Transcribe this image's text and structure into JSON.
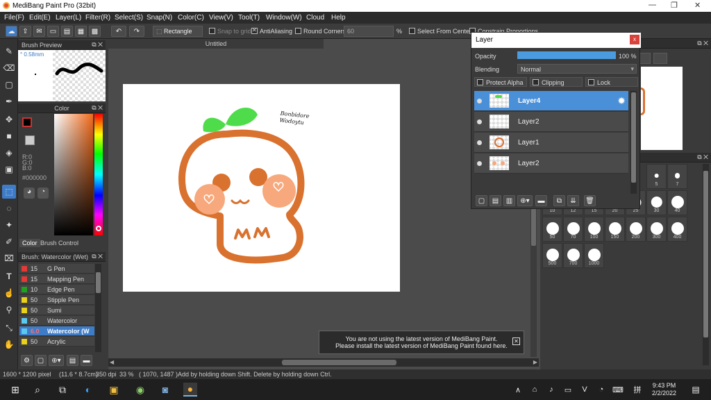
{
  "window": {
    "title": "MediBang Paint Pro (32bit)",
    "minimize": "—",
    "restore": "❐",
    "close": "✕"
  },
  "menu": [
    "File(F)",
    "Edit(E)",
    "Layer(L)",
    "Filter(R)",
    "Select(S)",
    "Snap(N)",
    "Color(C)",
    "View(V)",
    "Tool(T)",
    "Window(W)",
    "Cloud",
    "Help"
  ],
  "toolbar": {
    "shape": "Rectangle",
    "snap_to_grid": "Snap to grid",
    "antialiasing": "AntiAliasing",
    "round_corners": "Round Corners",
    "round_value": "60",
    "percent": "%",
    "select_from_center": "Select From Center",
    "constrain": "Constrain Proportions"
  },
  "brush_preview": {
    "title": "Brush Preview",
    "size": "0.58mm"
  },
  "color_panel": {
    "title": "Color",
    "r": "R:0",
    "g": "G:0",
    "b": "B:0",
    "hex": "#000000",
    "tab_color": "Color",
    "tab_brush_control": "Brush Control"
  },
  "brush_panel": {
    "title": "Brush: Watercolor (Wet)",
    "items": [
      {
        "size": "15",
        "name": "G Pen",
        "color": "#e53935"
      },
      {
        "size": "15",
        "name": "Mapping Pen",
        "color": "#e53935"
      },
      {
        "size": "10",
        "name": "Edge Pen",
        "color": "#1fa31f"
      },
      {
        "size": "50",
        "name": "Stipple Pen",
        "color": "#e8d21a"
      },
      {
        "size": "50",
        "name": "Sumi",
        "color": "#e8d21a"
      },
      {
        "size": "50",
        "name": "Watercolor",
        "color": "#5bc8f0"
      },
      {
        "size": "6.0",
        "name": "Watercolor (W",
        "color": "#5bc8f0"
      },
      {
        "size": "50",
        "name": "Acrylic",
        "color": "#e8d21a"
      }
    ]
  },
  "document": {
    "tab": "Untitled",
    "sig_line1": "Bonbidore",
    "sig_line2": "Wodoytu"
  },
  "layer_panel": {
    "title": "Layer",
    "close": "x",
    "opacity_label": "Opacity",
    "opacity_value": "100 %",
    "opacity_fraction": 1.0,
    "blending_label": "Blending",
    "blending_value": "Normal",
    "protect_alpha": "Protect Alpha",
    "clipping": "Clipping",
    "lock": "Lock",
    "layers": [
      {
        "name": "Layer4",
        "selected": true
      },
      {
        "name": "Layer2",
        "selected": false
      },
      {
        "name": "Layer1",
        "selected": false
      },
      {
        "name": "Layer2",
        "selected": false
      }
    ]
  },
  "brush_sizes": [
    "5",
    "7",
    "10",
    "12",
    "15",
    "20",
    "25",
    "30",
    "40",
    "50",
    "70",
    "100",
    "150",
    "200",
    "300",
    "400",
    "500",
    "700",
    "1000"
  ],
  "notification": {
    "line1": "You are not using the latest version of MediBang Paint.",
    "line2": "Please install the latest version of MediBang Paint found here."
  },
  "status": {
    "size": "1600 * 1200 pixel",
    "physical": "(11.6 * 8.7cm)",
    "dpi": "350 dpi",
    "zoom": "33 %",
    "coords": "( 1070, 1487 )",
    "hint": "Add by holding down Shift. Delete by holding down Ctrl."
  },
  "taskbar": {
    "time": "9:43 PM",
    "date": "2/2/2022"
  },
  "colors": {
    "accent": "#3e7cc8",
    "layer_selected": "#4a90d9",
    "character": "#d9712f",
    "leaf": "#4fdc4a",
    "cheek": "#f7a87c"
  }
}
